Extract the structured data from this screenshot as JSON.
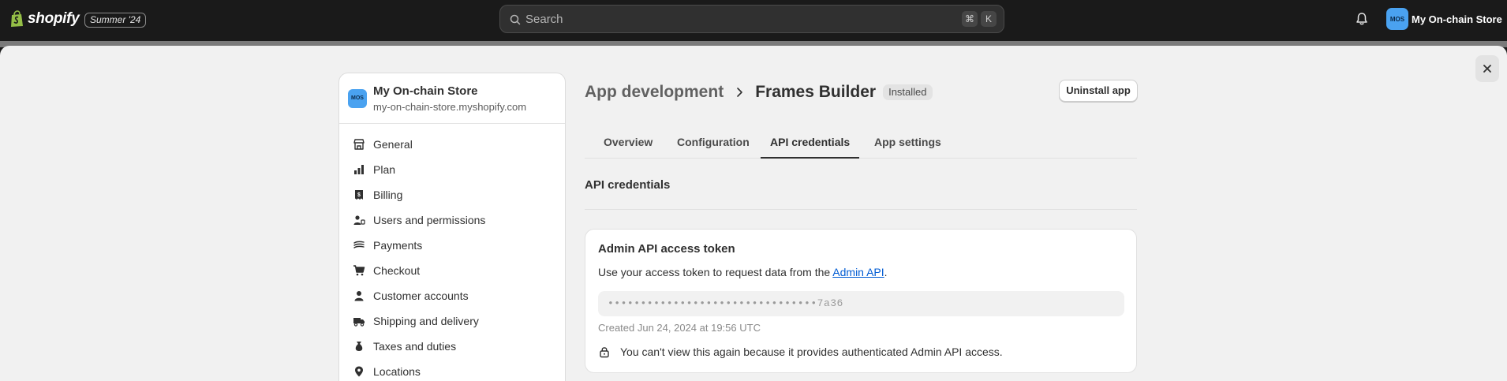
{
  "topbar": {
    "logo_text": "shopify",
    "edition_badge": "Summer '24",
    "search_placeholder": "Search",
    "shortcut_keys": [
      "⌘",
      "K"
    ],
    "store_avatar": "MOS",
    "store_name": "My On-chain Store"
  },
  "sidebar": {
    "avatar": "MOS",
    "store_name": "My On-chain Store",
    "store_url": "my-on-chain-store.myshopify.com",
    "items": [
      {
        "label": "General",
        "icon": "store-icon"
      },
      {
        "label": "Plan",
        "icon": "plan-icon"
      },
      {
        "label": "Billing",
        "icon": "billing-icon"
      },
      {
        "label": "Users and permissions",
        "icon": "users-icon"
      },
      {
        "label": "Payments",
        "icon": "payments-icon"
      },
      {
        "label": "Checkout",
        "icon": "cart-icon"
      },
      {
        "label": "Customer accounts",
        "icon": "person-icon"
      },
      {
        "label": "Shipping and delivery",
        "icon": "truck-icon"
      },
      {
        "label": "Taxes and duties",
        "icon": "tax-icon"
      },
      {
        "label": "Locations",
        "icon": "location-icon"
      }
    ]
  },
  "main": {
    "breadcrumb": "App development",
    "title": "Frames Builder",
    "status_badge": "Installed",
    "uninstall_label": "Uninstall app",
    "tabs": [
      {
        "label": "Overview",
        "active": false
      },
      {
        "label": "Configuration",
        "active": false
      },
      {
        "label": "API credentials",
        "active": true
      },
      {
        "label": "App settings",
        "active": false
      }
    ],
    "section_title": "API credentials",
    "card": {
      "title": "Admin API access token",
      "desc_prefix": "Use your access token to request data from the ",
      "desc_link": "Admin API",
      "desc_suffix": ".",
      "token_masked": "••••••••••••••••••••••••••••••••7a36",
      "created": "Created Jun 24, 2024 at 19:56 UTC",
      "warning": "You can't view this again because it provides authenticated Admin API access."
    }
  },
  "colors": {
    "topbar_bg": "#1a1a1a",
    "page_bg": "#f1f1f1",
    "avatar": "#4aa2f0",
    "link": "#005bd3",
    "logo_green": "#95bf47"
  }
}
